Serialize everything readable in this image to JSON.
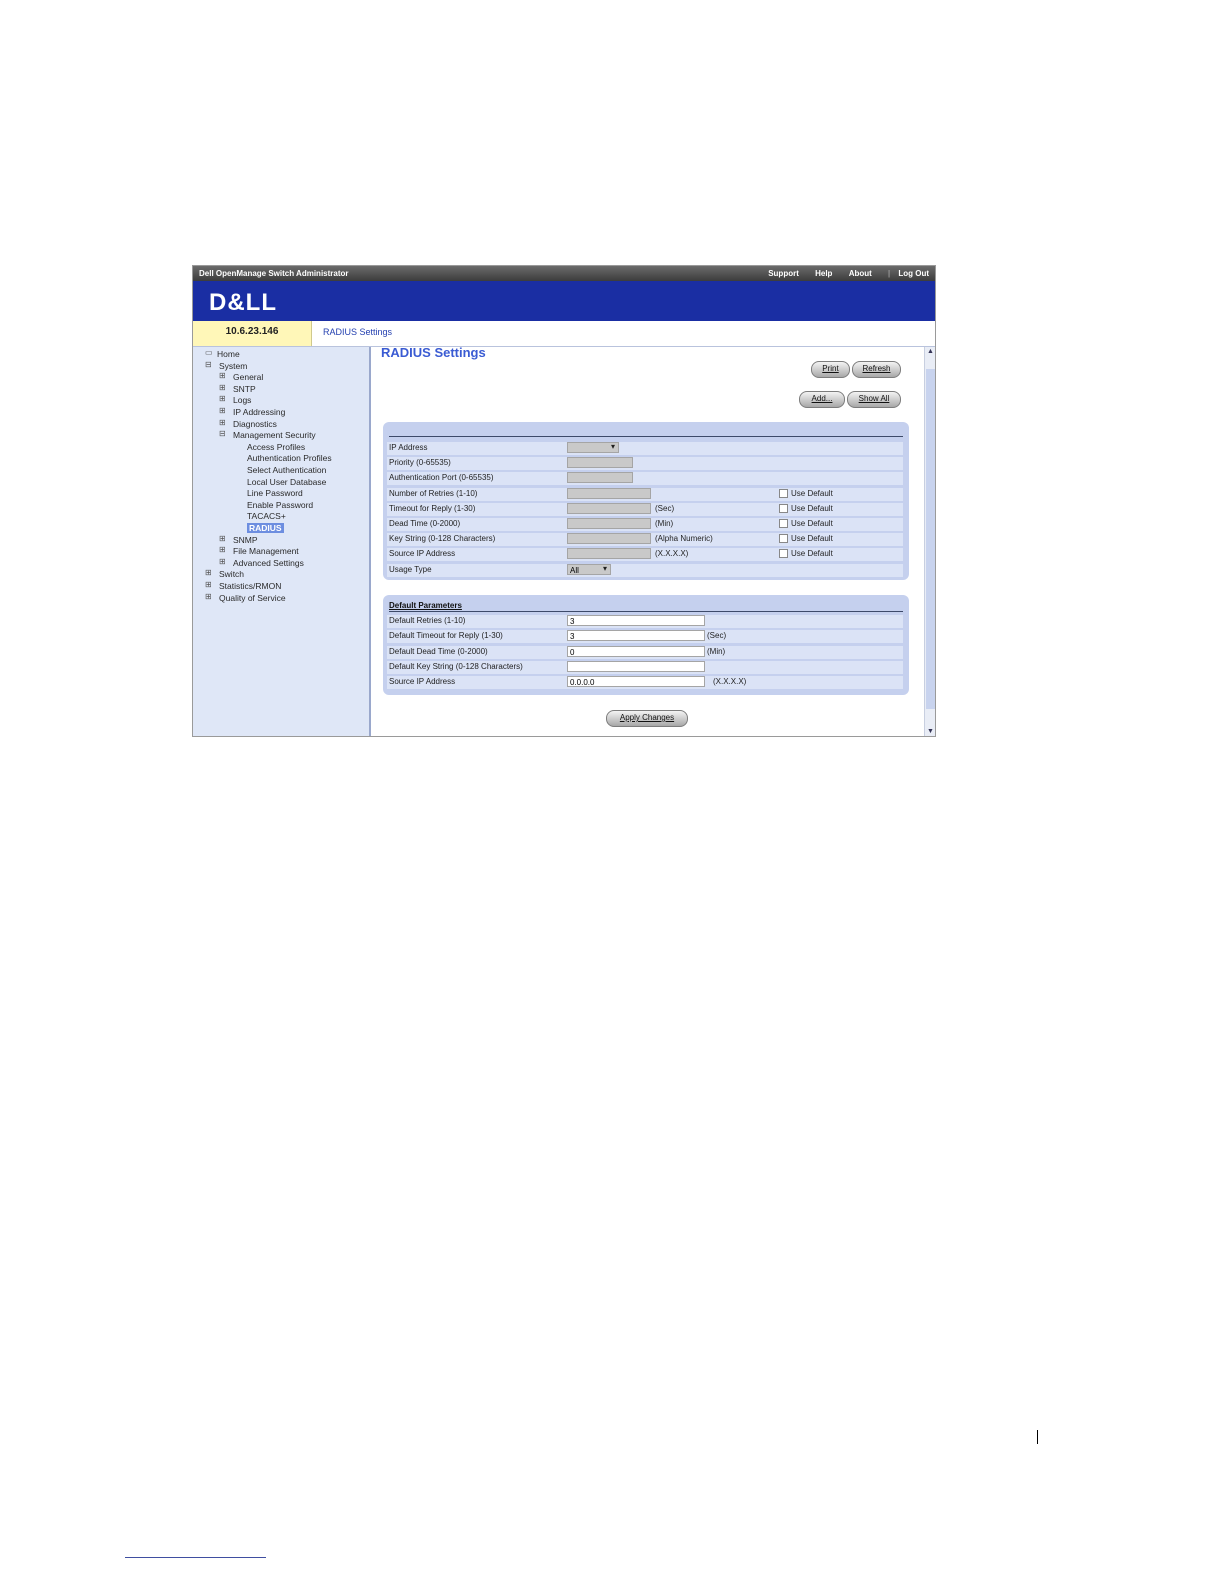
{
  "topbar": {
    "app_title": "Dell OpenManage Switch Administrator",
    "links": [
      "Support",
      "Help",
      "About",
      "Log Out"
    ]
  },
  "brand": {
    "logo": "D&LL"
  },
  "address": {
    "ip": "10.6.23.146",
    "breadcrumb": "RADIUS Settings"
  },
  "tree": [
    {
      "label": "Home",
      "icon": "folder-icon"
    },
    {
      "label": "System",
      "expander": "-"
    },
    {
      "label": "General",
      "expander": "+"
    },
    {
      "label": "SNTP",
      "expander": "+"
    },
    {
      "label": "Logs",
      "expander": "+"
    },
    {
      "label": "IP Addressing",
      "expander": "+"
    },
    {
      "label": "Diagnostics",
      "expander": "+"
    },
    {
      "label": "Management Security",
      "expander": "-"
    },
    {
      "label": "Access Profiles"
    },
    {
      "label": "Authentication Profiles"
    },
    {
      "label": "Select Authentication"
    },
    {
      "label": "Local User Database"
    },
    {
      "label": "Line Password"
    },
    {
      "label": "Enable Password"
    },
    {
      "label": "TACACS+"
    },
    {
      "label": "RADIUS",
      "selected": true
    },
    {
      "label": "SNMP",
      "expander": "+"
    },
    {
      "label": "File Management",
      "expander": "+"
    },
    {
      "label": "Advanced Settings",
      "expander": "+"
    },
    {
      "label": "Switch",
      "expander": "+"
    },
    {
      "label": "Statistics/RMON",
      "expander": "+"
    },
    {
      "label": "Quality of Service",
      "expander": "+"
    }
  ],
  "page": {
    "title": "RADIUS Settings",
    "print_label": "Print",
    "refresh_label": "Refresh",
    "add_label": "Add...",
    "show_all_label": "Show All",
    "apply_label": "Apply Changes"
  },
  "server": {
    "rows": [
      {
        "label": "IP Address",
        "control": "select",
        "value": ""
      },
      {
        "label": "Priority (0-65535)",
        "control": "input",
        "value": ""
      },
      {
        "label": "Authentication Port (0-65535)",
        "control": "input",
        "value": ""
      },
      {
        "label": "Number of Retries (1-10)",
        "control": "input",
        "value": "",
        "use_default": "Use Default"
      },
      {
        "label": "Timeout for Reply (1-30)",
        "control": "input",
        "value": "",
        "unit": "(Sec)",
        "use_default": "Use Default"
      },
      {
        "label": "Dead Time (0-2000)",
        "control": "input",
        "value": "",
        "unit": "(Min)",
        "use_default": "Use Default"
      },
      {
        "label": "Key String (0-128 Characters)",
        "control": "input",
        "value": "",
        "unit": "(Alpha Numeric)",
        "use_default": "Use Default"
      },
      {
        "label": "Source IP Address",
        "control": "input",
        "value": "",
        "unit": "(X.X.X.X)",
        "use_default": "Use Default"
      },
      {
        "label": "Usage Type",
        "control": "select-small",
        "value": "All"
      }
    ]
  },
  "defaults": {
    "heading": "Default Parameters",
    "rows": [
      {
        "label": "Default Retries (1-10)",
        "value": "3"
      },
      {
        "label": "Default Timeout for Reply (1-30)",
        "value": "3",
        "unit": "(Sec)"
      },
      {
        "label": "Default Dead Time (0-2000)",
        "value": "0",
        "unit": "(Min)"
      },
      {
        "label": "Default Key String (0-128 Characters)",
        "value": ""
      },
      {
        "label": "Source IP Address",
        "value": "0.0.0.0",
        "unit": "(X.X.X.X)"
      }
    ]
  }
}
